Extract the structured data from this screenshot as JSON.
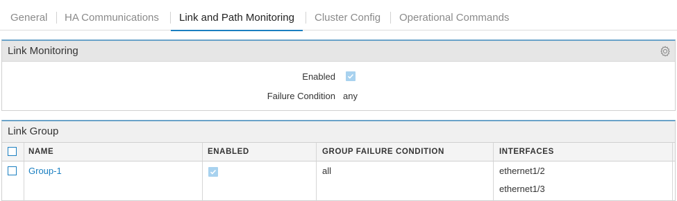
{
  "tabs": [
    {
      "label": "General"
    },
    {
      "label": "HA Communications"
    },
    {
      "label": "Link and Path Monitoring",
      "active": true
    },
    {
      "label": "Cluster Config"
    },
    {
      "label": "Operational Commands"
    }
  ],
  "link_monitoring": {
    "title": "Link Monitoring",
    "settings_icon": "gear-icon",
    "enabled_label": "Enabled",
    "enabled": true,
    "failure_condition_label": "Failure Condition",
    "failure_condition_value": "any"
  },
  "link_group": {
    "title": "Link Group",
    "columns": [
      "NAME",
      "ENABLED",
      "GROUP FAILURE CONDITION",
      "INTERFACES"
    ],
    "rows": [
      {
        "name": "Group-1",
        "enabled": true,
        "group_failure_condition": "all",
        "interfaces": [
          "ethernet1/2",
          "ethernet1/3"
        ]
      }
    ]
  },
  "colors": {
    "accent": "#1a7fc1",
    "checkbox_checked": "#a8d2ef",
    "header_bg": "#e6e6e6"
  }
}
